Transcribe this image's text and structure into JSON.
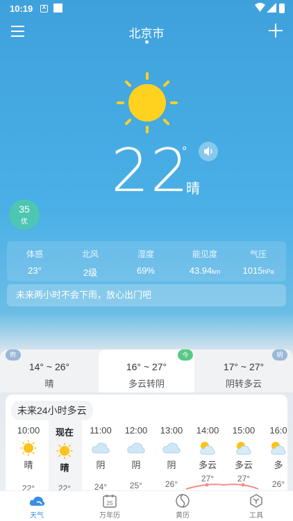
{
  "status_bar": {
    "time": "10:19",
    "notif_letter": "A"
  },
  "header": {
    "city": "北京市"
  },
  "current": {
    "temp": "22",
    "degree": "°",
    "condition": "晴"
  },
  "aqi": {
    "value": "35",
    "level": "优"
  },
  "metrics": [
    {
      "label": "体感",
      "value": "23°",
      "unit": ""
    },
    {
      "label": "北风",
      "value": "2级",
      "unit": ""
    },
    {
      "label": "湿度",
      "value": "69%",
      "unit": ""
    },
    {
      "label": "能见度",
      "value": "43.94",
      "unit": "km"
    },
    {
      "label": "气压",
      "value": "1015",
      "unit": "hPa"
    }
  ],
  "notice": "未来两小时不会下雨，放心出门吧",
  "days": [
    {
      "tag": "昨",
      "range": "14° ~ 26°",
      "cond": "晴"
    },
    {
      "tag": "今",
      "range": "16° ~ 27°",
      "cond": "多云转阴"
    },
    {
      "tag": "明",
      "range": "17° ~ 27°",
      "cond": "阴转多云"
    }
  ],
  "hourly_title": "未来24小时多云",
  "hours": [
    {
      "time": "10:00",
      "cond": "晴",
      "icon": "sun-icon",
      "temp": "22°"
    },
    {
      "time": "现在",
      "cond": "晴",
      "icon": "sun-icon",
      "temp": "22°"
    },
    {
      "time": "11:00",
      "cond": "阴",
      "icon": "cloud-icon",
      "temp": "24°"
    },
    {
      "time": "12:00",
      "cond": "阴",
      "icon": "cloud-icon",
      "temp": "25°"
    },
    {
      "time": "13:00",
      "cond": "阴",
      "icon": "cloud-icon",
      "temp": "26°"
    },
    {
      "time": "14:00",
      "cond": "多云",
      "icon": "partly-cloudy-icon",
      "temp": "27°"
    },
    {
      "time": "15:00",
      "cond": "多云",
      "icon": "partly-cloudy-icon",
      "temp": "27°"
    },
    {
      "time": "16:0",
      "cond": "多",
      "icon": "partly-cloudy-icon",
      "temp": "26°"
    }
  ],
  "nav": [
    {
      "label": "天气",
      "icon": "weather-icon"
    },
    {
      "label": "万年历",
      "icon": "calendar-icon",
      "badge": "25"
    },
    {
      "label": "黄历",
      "icon": "almanac-icon"
    },
    {
      "label": "工具",
      "icon": "tools-icon"
    }
  ],
  "colors": {
    "accent": "#3a8fe0",
    "aqi_good": "#4dc6b3",
    "sun": "#ffd21f"
  }
}
